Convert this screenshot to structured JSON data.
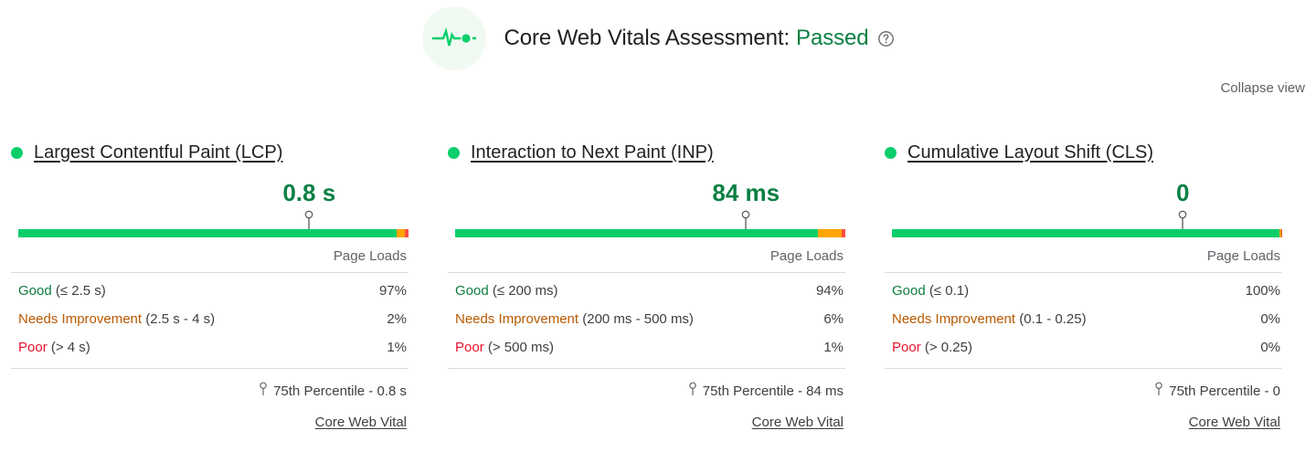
{
  "header": {
    "icon": "pulse-icon",
    "title_prefix": "Core Web Vitals Assessment:",
    "verdict": "Passed",
    "verdict_color": "#0b8043",
    "help_icon": "help-circle-icon",
    "badge_bg": "#f1faf2"
  },
  "collapse": {
    "label": "Collapse view"
  },
  "colors": {
    "good": "#0cce6b",
    "needs_improvement": "#ffa400",
    "poor": "#ff4e42",
    "good_text": "#0d7e3e",
    "ni_text": "#b85800",
    "poor_text": "#e8112d",
    "value_text": "#0b8043"
  },
  "common": {
    "column_header": "Page Loads",
    "percentile_label": "75th Percentile",
    "percentile_icon": "pin-marker-icon",
    "core_web_vital_link": "Core Web Vital",
    "good_label": "Good",
    "ni_label": "Needs Improvement",
    "poor_label": "Poor"
  },
  "metrics": [
    {
      "name": "Largest Contentful Paint (LCP)",
      "status": "good",
      "value": "0.8 s",
      "needle_pct": 75,
      "percentile_text": "75th Percentile - 0.8 s",
      "buckets": [
        {
          "label": "Good",
          "klass": "label-good",
          "range": "(≤ 2.5 s)",
          "pct": "97%"
        },
        {
          "label": "Needs Improvement",
          "klass": "label-ni",
          "range": "(2.5 s - 4 s)",
          "pct": "2%"
        },
        {
          "label": "Poor",
          "klass": "label-poor",
          "range": "(> 4 s)",
          "pct": "1%"
        }
      ],
      "distribution": {
        "good": 97,
        "needs_improvement": 2,
        "poor": 1
      }
    },
    {
      "name": "Interaction to Next Paint (INP)",
      "status": "good",
      "value": "84 ms",
      "needle_pct": 75,
      "percentile_text": "75th Percentile - 84 ms",
      "buckets": [
        {
          "label": "Good",
          "klass": "label-good",
          "range": "(≤ 200 ms)",
          "pct": "94%"
        },
        {
          "label": "Needs Improvement",
          "klass": "label-ni",
          "range": "(200 ms - 500 ms)",
          "pct": "6%"
        },
        {
          "label": "Poor",
          "klass": "label-poor",
          "range": "(> 500 ms)",
          "pct": "1%"
        }
      ],
      "distribution": {
        "good": 93,
        "needs_improvement": 6,
        "poor": 1
      }
    },
    {
      "name": "Cumulative Layout Shift (CLS)",
      "status": "good",
      "value": "0",
      "needle_pct": 75,
      "percentile_text": "75th Percentile - 0",
      "buckets": [
        {
          "label": "Good",
          "klass": "label-good",
          "range": "(≤ 0.1)",
          "pct": "100%"
        },
        {
          "label": "Needs Improvement",
          "klass": "label-ni",
          "range": "(0.1 - 0.25)",
          "pct": "0%"
        },
        {
          "label": "Poor",
          "klass": "label-poor",
          "range": "(> 0.25)",
          "pct": "0%"
        }
      ],
      "distribution": {
        "good": 99.4,
        "needs_improvement": 0.3,
        "poor": 0.3
      }
    }
  ],
  "chart_data": {
    "type": "bar",
    "title": "Core Web Vitals Assessment: Passed",
    "xlabel": "",
    "ylabel": "Page Loads",
    "ylim": [
      0,
      100
    ],
    "categories": [
      "Good",
      "Needs Improvement",
      "Poor"
    ],
    "series": [
      {
        "name": "Largest Contentful Paint (LCP)",
        "values": [
          97,
          2,
          1
        ],
        "unit": "%",
        "p75": "0.8 s"
      },
      {
        "name": "Interaction to Next Paint (INP)",
        "values": [
          94,
          6,
          1
        ],
        "unit": "%",
        "p75": "84 ms"
      },
      {
        "name": "Cumulative Layout Shift (CLS)",
        "values": [
          100,
          0,
          0
        ],
        "unit": "%",
        "p75": "0"
      }
    ],
    "legend": [
      "Good",
      "Needs Improvement",
      "Poor"
    ],
    "legend_position": "inline-rows",
    "grid": false,
    "annotations": [
      "75th Percentile",
      "Core Web Vital"
    ]
  }
}
